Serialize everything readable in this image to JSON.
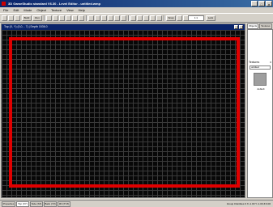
{
  "window": {
    "title": "3D GameStudio standard V6.30 - Level Editor - untitled.wmp"
  },
  "window_controls": {
    "minimize": "_",
    "maximize": "□",
    "close": "×"
  },
  "menu": [
    "File",
    "Edit",
    "Mode",
    "Object",
    "Texture",
    "View",
    "Help"
  ],
  "toolbar": {
    "build_label": "Build",
    "run_label": "Run",
    "zoom_value": "1:1",
    "snap_label": "Snap",
    "lock_label": "Lock",
    "zoom_label": "Zoom"
  },
  "viewport": {
    "header": "Top (X, Y) (0,0, - 7) | Depth 1536.0"
  },
  "object_panel": {
    "tabs": [
      "Objects",
      "Textures"
    ],
    "section_label": "Textures",
    "section_close": "x",
    "selector_value": "untitled",
    "object_name": "default"
  },
  "statusbar": {
    "tabs": [
      "Properties",
      "Top (XY)",
      "Side (XZ)",
      "Back (YZ)",
      "3D (XYZ)"
    ],
    "active_tab": 1,
    "right_text": "Group 0 Entities 0  X:-1.00  Y:-1.00  Z:0.00"
  },
  "colors": {
    "level_border": "#e00000",
    "viewport_bg": "#080808",
    "grid_line": "#3a3a3a",
    "titlebar": "#0a246a"
  }
}
